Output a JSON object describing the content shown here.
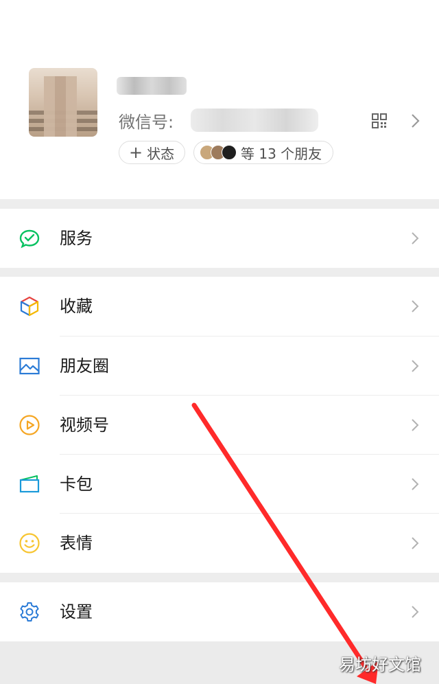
{
  "profile": {
    "wxid_label": "微信号:",
    "status_chip": "状态",
    "status_plus": "+",
    "friends_chip": "等 13 个朋友"
  },
  "menu": {
    "services": "服务",
    "favorites": "收藏",
    "moments": "朋友圈",
    "channels": "视频号",
    "cards": "卡包",
    "stickers": "表情",
    "settings": "设置"
  },
  "icons": {
    "services": "wechat-pay-icon",
    "favorites": "cube-icon",
    "moments": "image-icon",
    "channels": "play-circle-icon",
    "cards": "card-wallet-icon",
    "stickers": "smiley-icon",
    "settings": "gear-icon"
  },
  "colors": {
    "services": "#07c160",
    "moments": "#2b7bd6",
    "channels": "#f5a623",
    "cards": "#1a9ad9",
    "stickers": "#f7c531",
    "settings": "#2b7bd6",
    "annotation_arrow": "#ff2a2a"
  },
  "watermark": "易坊好文馆"
}
